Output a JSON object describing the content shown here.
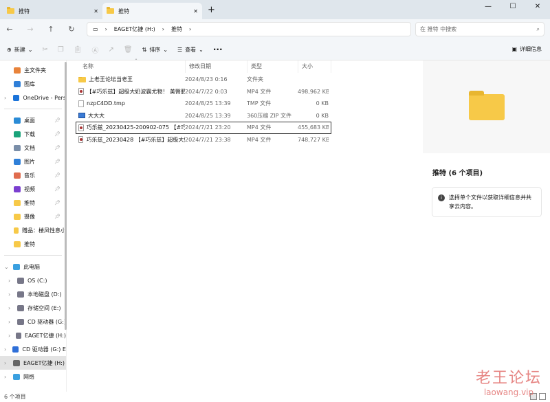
{
  "tabs": [
    {
      "label": "推特"
    },
    {
      "label": "推特"
    }
  ],
  "window": {
    "minimize": "—",
    "maximize": "☐",
    "close": "✕",
    "new_tab": "+"
  },
  "nav": {
    "back": "←",
    "forward": "→",
    "up": "↑",
    "refresh": "↻"
  },
  "breadcrumb": [
    "EAGET亿捷 (H:)",
    "推特"
  ],
  "search": {
    "placeholder": "在 推特 中搜索"
  },
  "toolbar": {
    "new": "新建",
    "sort": "排序",
    "view": "查看",
    "more": "···",
    "details": "详细信息"
  },
  "sidebar": {
    "top": [
      {
        "label": "主文件夹",
        "color": "#e8833a"
      },
      {
        "label": "图库",
        "color": "#2f7fd8"
      },
      {
        "label": "OneDrive - Pers",
        "color": "#1a73d9"
      }
    ],
    "quick": [
      {
        "label": "桌面",
        "color": "#2a8bd6"
      },
      {
        "label": "下载",
        "color": "#1aa37a"
      },
      {
        "label": "文档",
        "color": "#7a8ea8"
      },
      {
        "label": "图片",
        "color": "#2f7fd8"
      },
      {
        "label": "音乐",
        "color": "#e06c4e"
      },
      {
        "label": "视频",
        "color": "#7b3fd0"
      },
      {
        "label": "推特",
        "color": "#f7c948"
      },
      {
        "label": "摄像",
        "color": "#f7c948"
      },
      {
        "label": "赠品：楼凤性息小",
        "color": "#f7c948"
      },
      {
        "label": "推特",
        "color": "#f7c948"
      }
    ],
    "pc": {
      "label": "此电脑",
      "children": [
        "OS (C:)",
        "本地磁盘 (D:)",
        "存储空间 (E:)",
        "CD 驱动器 (G:)",
        "EAGET亿捷 (H:)"
      ]
    },
    "drives": [
      "CD 驱动器 (G:) E",
      "EAGET亿捷 (H:)",
      "网络"
    ]
  },
  "columns": [
    "名称",
    "修改日期",
    "类型",
    "大小"
  ],
  "files": [
    {
      "name": "上老王论坛当老王",
      "date": "2024/8/23 0:16",
      "type": "文件夹",
      "size": "",
      "icon": "folder"
    },
    {
      "name": "【#巧乐兹】超级大奶波霸尤物！ 美臀肥...",
      "date": "2024/7/22 0:03",
      "type": "MP4 文件",
      "size": "498,962 KB",
      "icon": "mp4"
    },
    {
      "name": "nzpC4DD.tmp",
      "date": "2024/8/25 13:39",
      "type": "TMP 文件",
      "size": "0 KB",
      "icon": "tmp"
    },
    {
      "name": "大大大",
      "date": "2024/8/25 13:39",
      "type": "360压缩 ZIP 文件",
      "size": "0 KB",
      "icon": "zip"
    },
    {
      "name": "巧乐兹_20230425-200902-075 【#巧...",
      "date": "2024/7/21 23:20",
      "type": "MP4 文件",
      "size": "455,683 KB",
      "icon": "mp4"
    },
    {
      "name": "巧乐兹_20230428 【#巧乐兹】超级大奶...",
      "date": "2024/7/21 23:38",
      "type": "MP4 文件",
      "size": "748,727 KB",
      "icon": "mp4"
    }
  ],
  "details": {
    "title": "推特 (6 个项目)",
    "info": "选择单个文件以获取详细信息并共享云内容。"
  },
  "status": "6 个项目",
  "watermark": {
    "line1": "老王论坛",
    "line2": "laowang.vip"
  }
}
